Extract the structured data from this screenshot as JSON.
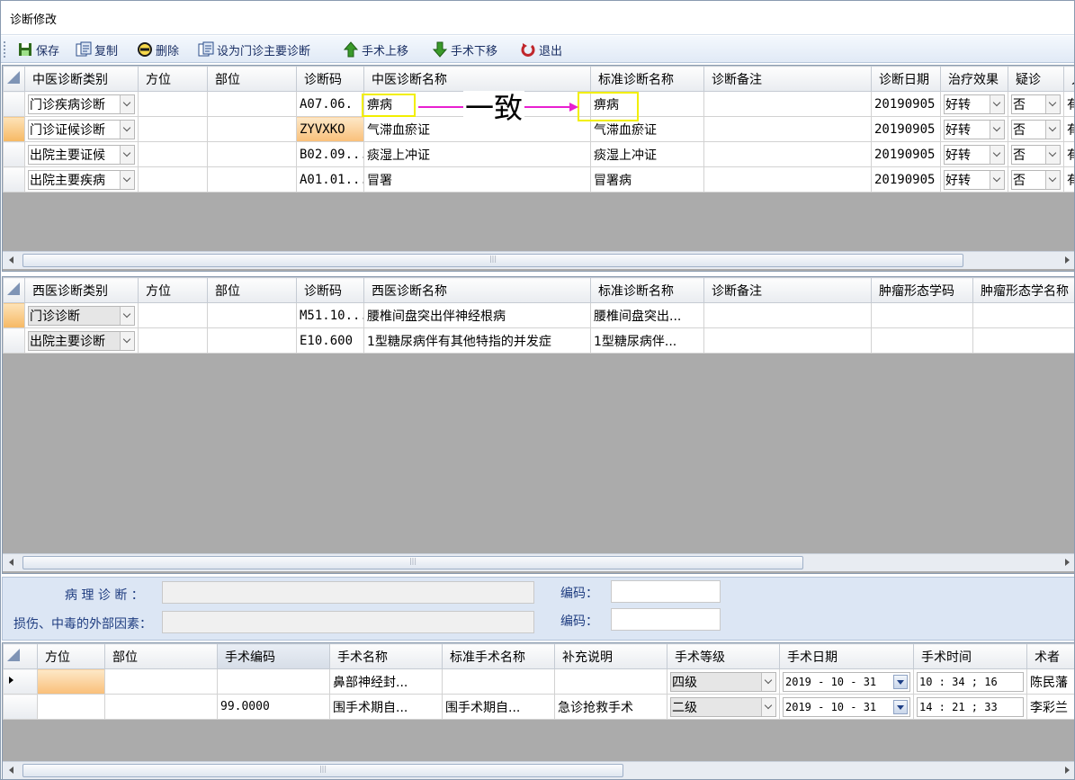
{
  "window": {
    "title": "诊断修改"
  },
  "toolbar": [
    {
      "label": "保存",
      "icon": "save-icon"
    },
    {
      "label": "复制",
      "icon": "copy-icon"
    },
    {
      "label": "删除",
      "icon": "delete-icon"
    },
    {
      "label": "设为门诊主要诊断",
      "icon": "set-main-icon"
    },
    {
      "label": "手术上移",
      "icon": "arrow-up-icon"
    },
    {
      "label": "手术下移",
      "icon": "arrow-down-icon"
    },
    {
      "label": "退出",
      "icon": "exit-icon"
    }
  ],
  "tcm": {
    "headers": [
      "中医诊断类别",
      "方位",
      "部位",
      "诊断码",
      "中医诊断名称",
      "标准诊断名称",
      "诊断备注",
      "诊断日期",
      "治疗效果",
      "疑诊",
      "入"
    ],
    "rows": [
      {
        "category": "门诊疾病诊断",
        "code": "A07.06.",
        "name": "痹病",
        "standard": "痹病",
        "date": "20190905",
        "effect": "好转",
        "suspect": "否",
        "extra": "有"
      },
      {
        "category": "门诊证候诊断",
        "code": "ZYVXKO",
        "name": "气滞血瘀证",
        "standard": "气滞血瘀证",
        "date": "20190905",
        "effect": "好转",
        "suspect": "否",
        "extra": "有"
      },
      {
        "category": "出院主要证候",
        "code": "B02.09...",
        "name": "痰湿上冲证",
        "standard": "痰湿上冲证",
        "date": "20190905",
        "effect": "好转",
        "suspect": "否",
        "extra": "有"
      },
      {
        "category": "出院主要疾病",
        "code": "A01.01...",
        "name": "冒署",
        "standard": "冒署病",
        "date": "20190905",
        "effect": "好转",
        "suspect": "否",
        "extra": "有"
      }
    ],
    "annotation": "一致"
  },
  "wm": {
    "headers": [
      "西医诊断类别",
      "方位",
      "部位",
      "诊断码",
      "西医诊断名称",
      "标准诊断名称",
      "诊断备注",
      "肿瘤形态学码",
      "肿瘤形态学名称"
    ],
    "rows": [
      {
        "category": "门诊诊断",
        "code": "M51.10...",
        "name": "腰椎间盘突出伴神经根病",
        "standard": "腰椎间盘突出..."
      },
      {
        "category": "出院主要诊断",
        "code": "E10.600",
        "name": "1型糖尿病伴有其他特指的并发症",
        "standard": "1型糖尿病伴..."
      }
    ]
  },
  "pathology": {
    "label": "病 理 诊 断 ：",
    "code_label": "编码：",
    "value": "",
    "code": ""
  },
  "injury": {
    "label": "损伤、中毒的外部因素：",
    "code_label": "编码：",
    "value": "",
    "code": ""
  },
  "surgery": {
    "headers": [
      "方位",
      "部位",
      "手术编码",
      "手术名称",
      "标准手术名称",
      "补充说明",
      "手术等级",
      "手术日期",
      "手术时间",
      "术者"
    ],
    "rows": [
      {
        "code": "",
        "name": "鼻部神经封...",
        "standard": "",
        "note": "",
        "level": "四级",
        "date": "2019 - 10 - 31",
        "time": "10 : 34 ; 16",
        "surgeon": "陈民藩"
      },
      {
        "code": "99.0000",
        "name": "围手术期自...",
        "standard": "围手术期自...",
        "note": "急诊抢救手术",
        "level": "二级",
        "date": "2019 - 10 - 31",
        "time": "14 : 21 ; 33",
        "surgeon": "李彩兰"
      }
    ]
  }
}
